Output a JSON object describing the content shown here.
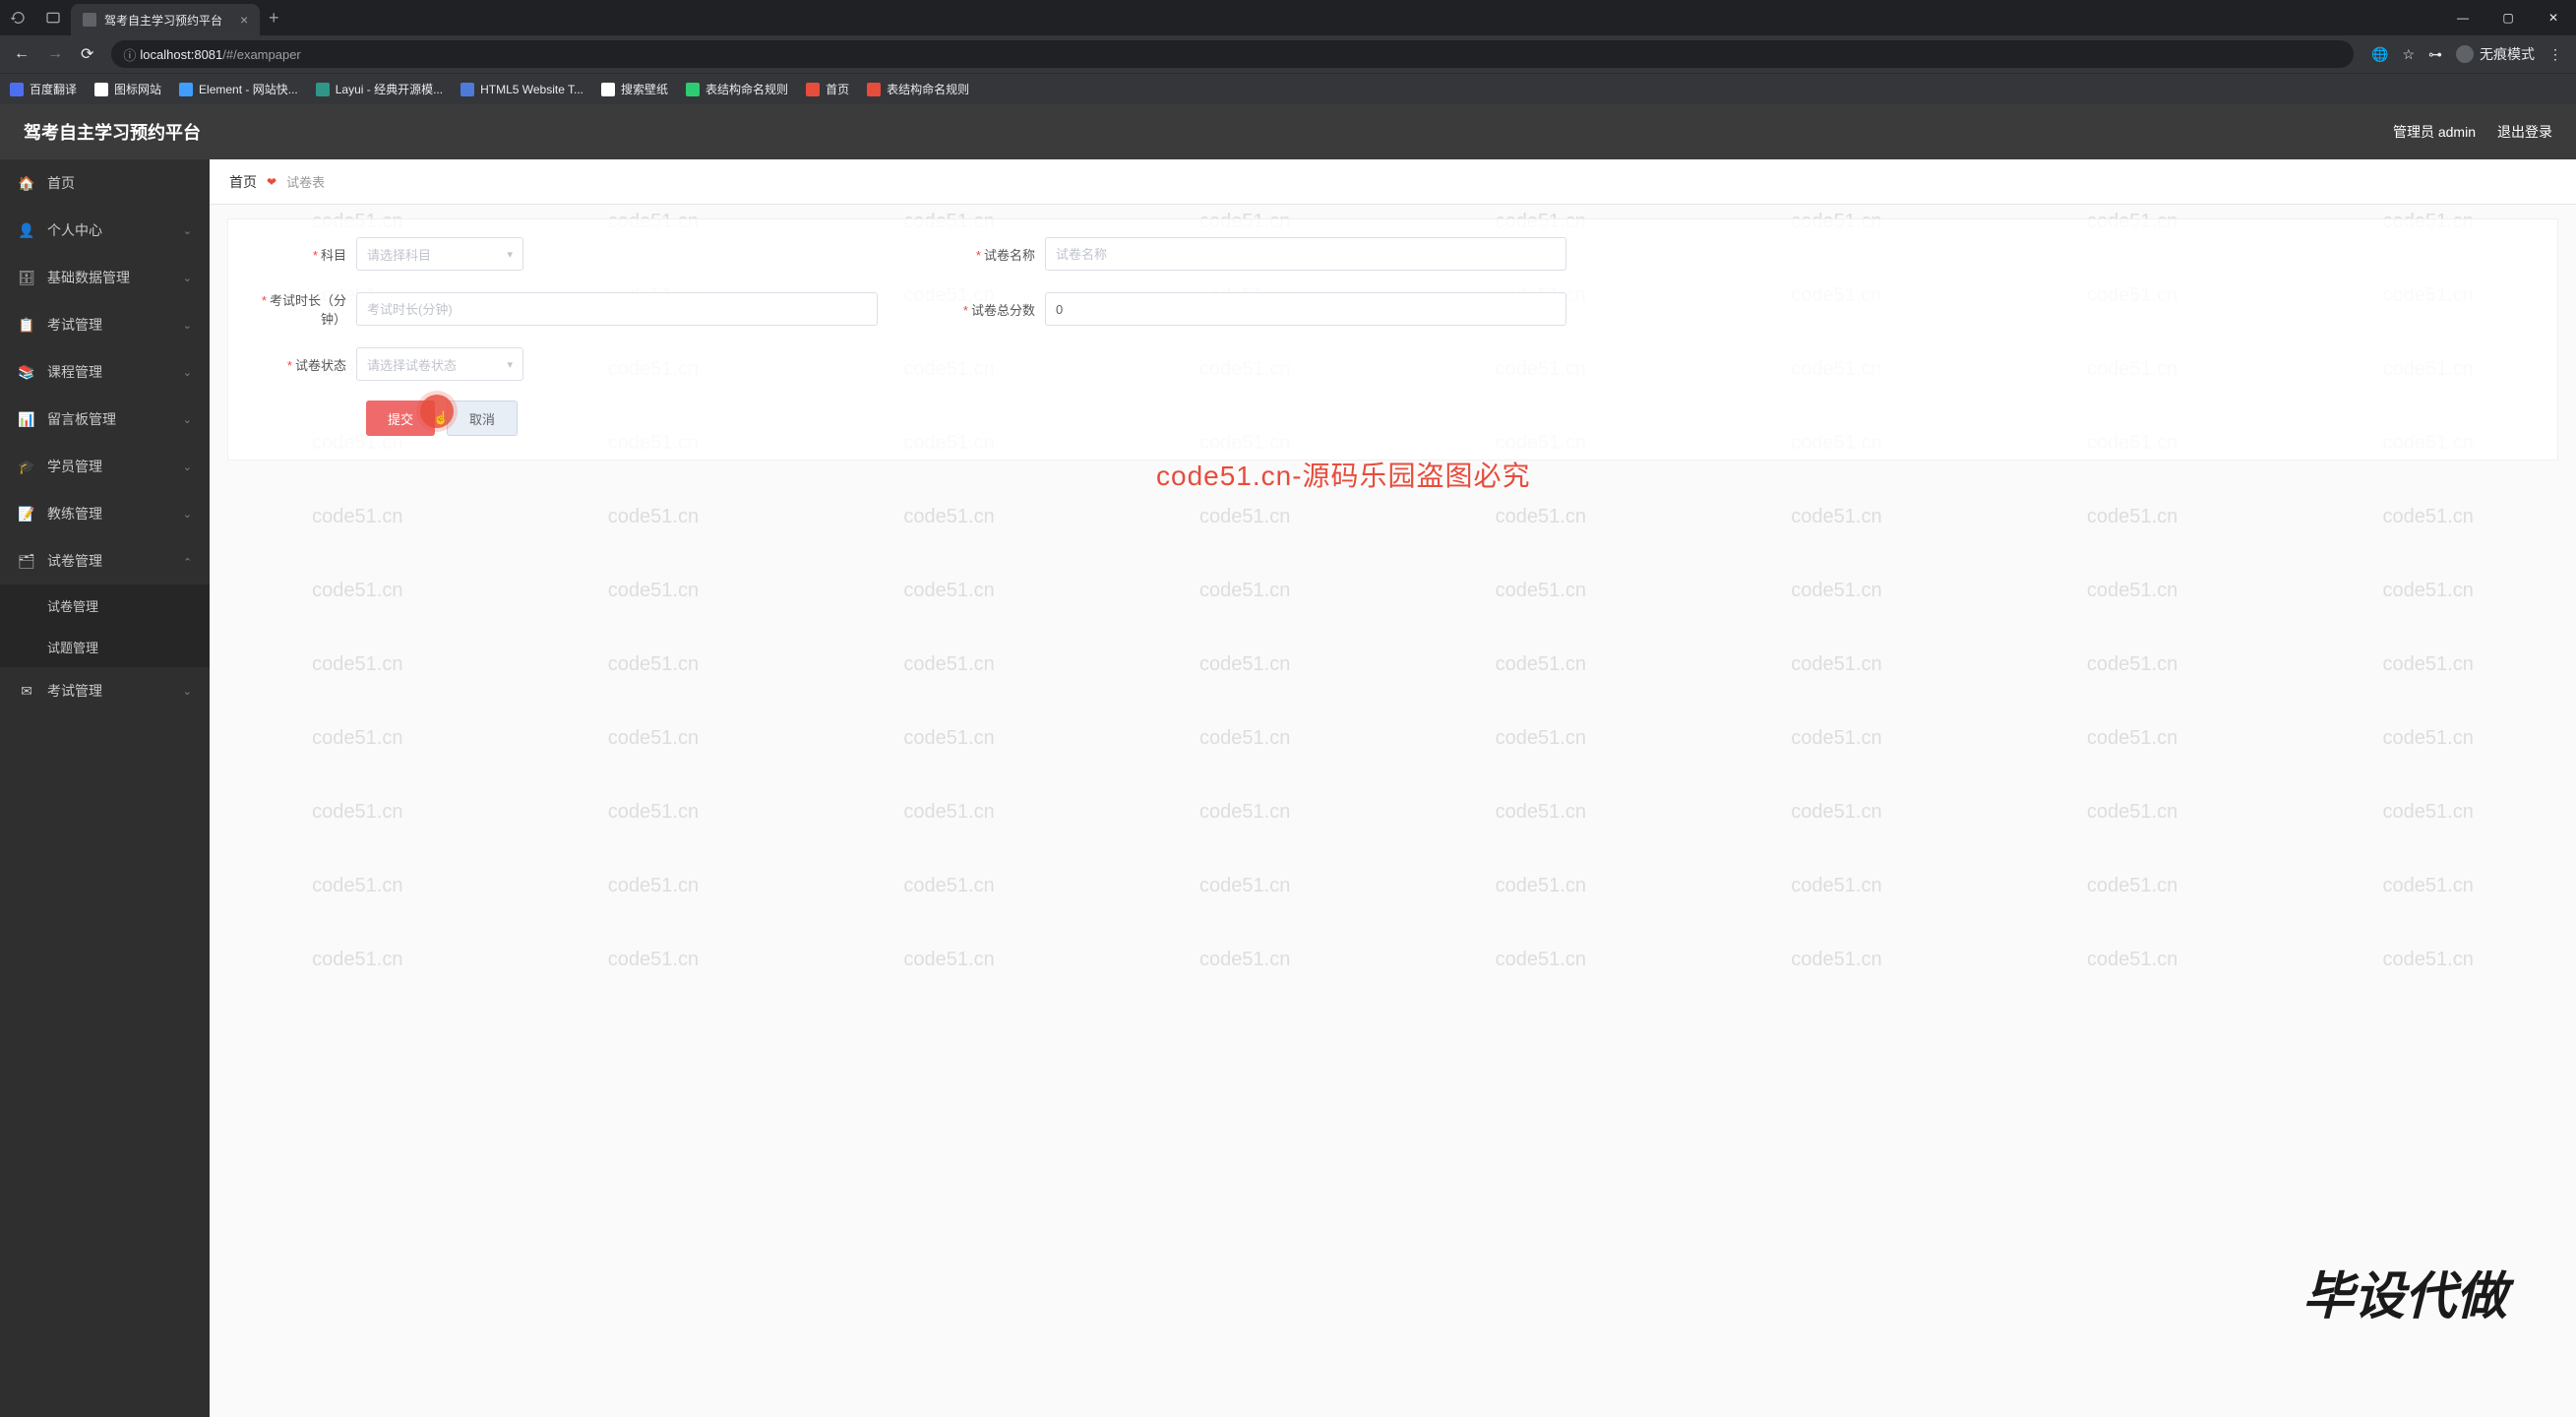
{
  "browser": {
    "tab_title": "驾考自主学习预约平台",
    "url_host": "localhost:8081",
    "url_path": "/#/exampaper",
    "incognito_label": "无痕模式",
    "bookmarks": [
      {
        "label": "百度翻译",
        "color": "#4e6ef2"
      },
      {
        "label": "图标网站",
        "color": "#ffffff"
      },
      {
        "label": "Element - 网站快...",
        "color": "#409eff"
      },
      {
        "label": "Layui - 经典开源模...",
        "color": "#2f9688"
      },
      {
        "label": "HTML5 Website T...",
        "color": "#4c7bd9"
      },
      {
        "label": "搜索壁纸",
        "color": "#ffffff"
      },
      {
        "label": "表结构命名规则",
        "color": "#2ecc71"
      },
      {
        "label": "首页",
        "color": "#e74c3c"
      },
      {
        "label": "表结构命名规则",
        "color": "#e74c3c"
      }
    ]
  },
  "app": {
    "title": "驾考自主学习预约平台",
    "admin_label": "管理员 admin",
    "logout_label": "退出登录"
  },
  "sidebar": {
    "items": [
      {
        "label": "首页",
        "expandable": false
      },
      {
        "label": "个人中心",
        "expandable": true
      },
      {
        "label": "基础数据管理",
        "expandable": true
      },
      {
        "label": "考试管理",
        "expandable": true
      },
      {
        "label": "课程管理",
        "expandable": true
      },
      {
        "label": "留言板管理",
        "expandable": true
      },
      {
        "label": "学员管理",
        "expandable": true
      },
      {
        "label": "教练管理",
        "expandable": true
      },
      {
        "label": "试卷管理",
        "expandable": true,
        "open": true,
        "children": [
          "试卷管理",
          "试题管理"
        ]
      },
      {
        "label": "考试管理",
        "expandable": true
      }
    ]
  },
  "breadcrumb": {
    "home": "首页",
    "current": "试卷表"
  },
  "form": {
    "subject_label": "科目",
    "subject_placeholder": "请选择科目",
    "name_label": "试卷名称",
    "name_placeholder": "试卷名称",
    "duration_label": "考试时长（分钟）",
    "duration_placeholder": "考试时长(分钟)",
    "total_label": "试卷总分数",
    "total_value": "0",
    "status_label": "试卷状态",
    "status_placeholder": "请选择试卷状态",
    "submit": "提交",
    "cancel": "取消"
  },
  "watermark": {
    "text": "code51.cn",
    "big": "code51.cn-源码乐园盗图必究",
    "corner": "毕设代做"
  }
}
